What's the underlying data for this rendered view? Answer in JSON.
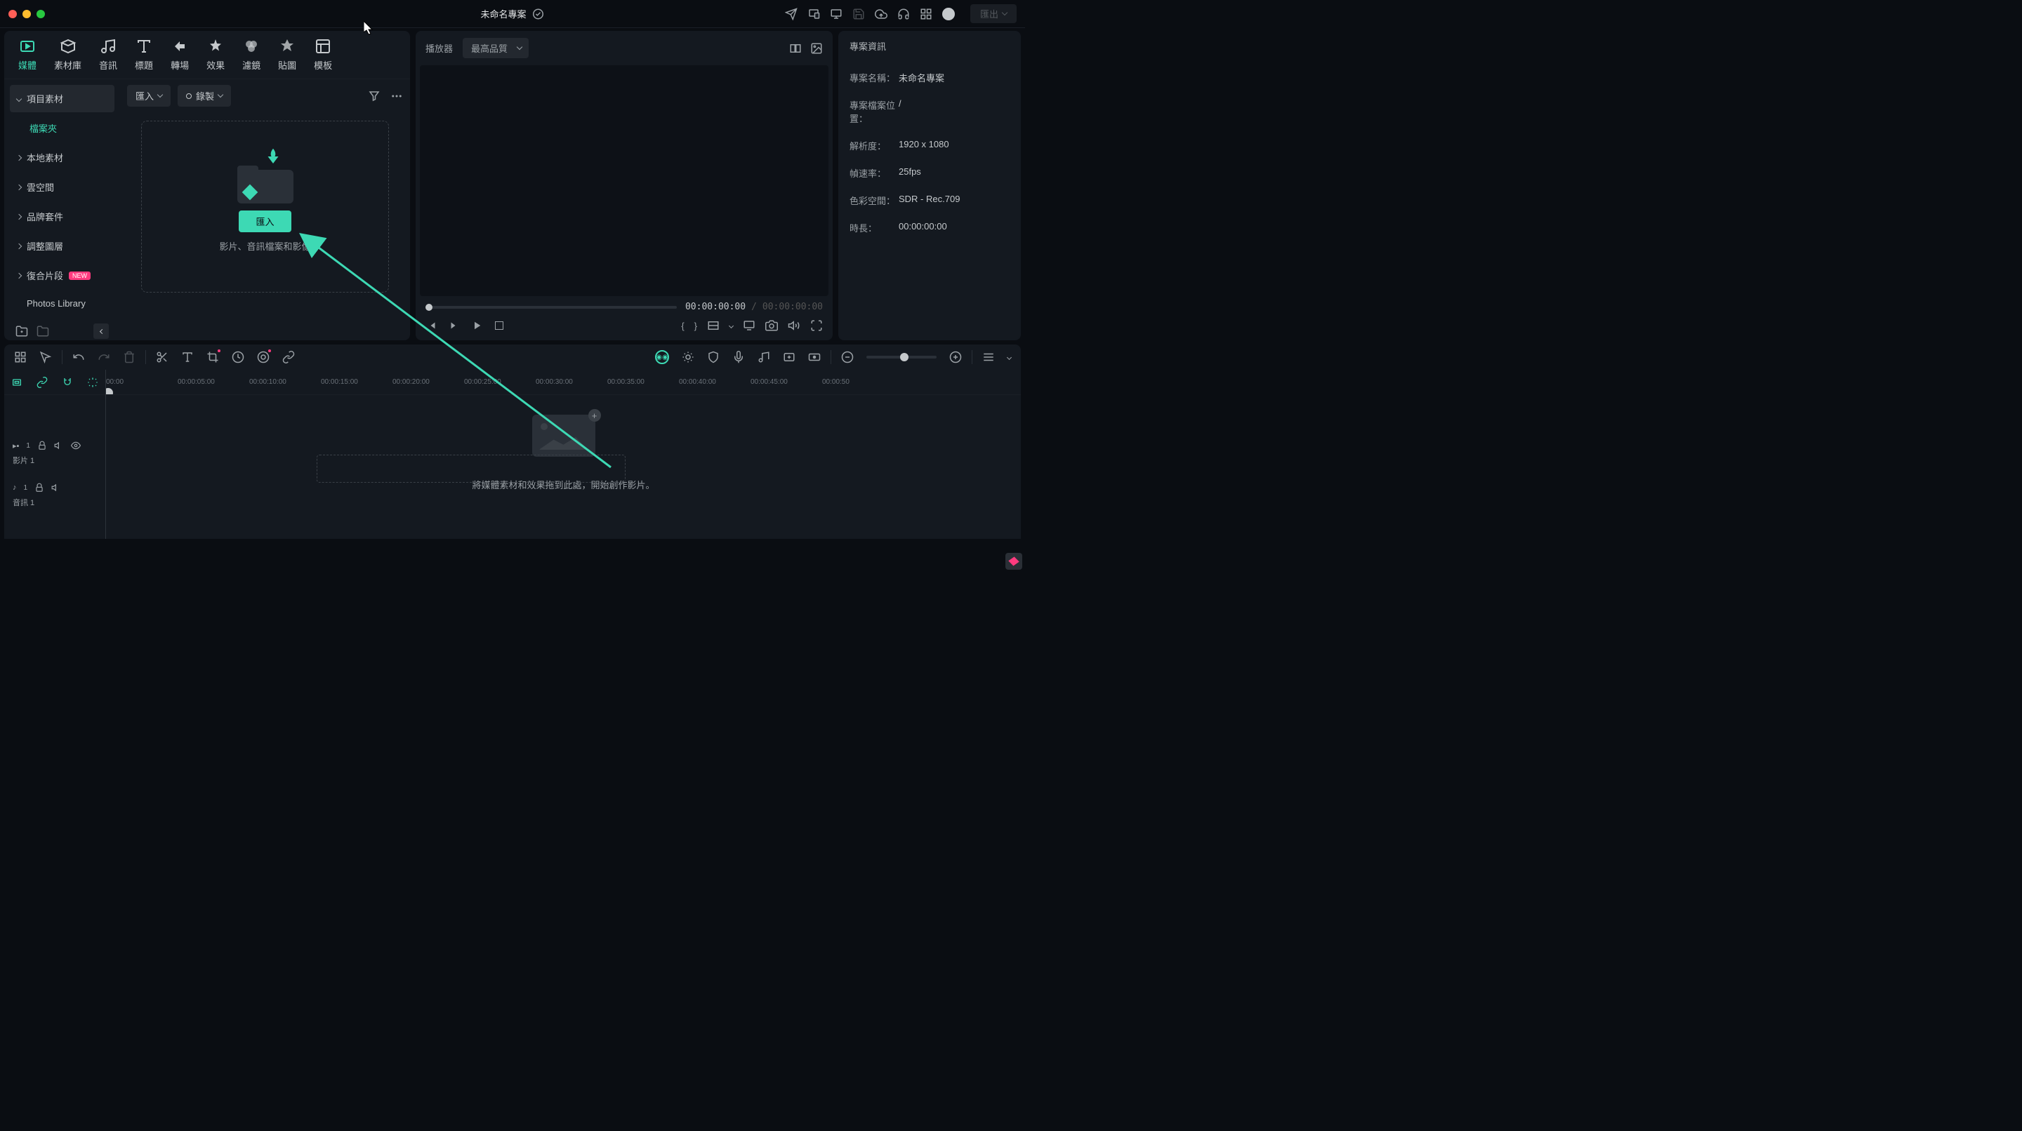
{
  "title": "未命名專案",
  "export_label": "匯出",
  "tool_tabs": [
    "媒體",
    "素材庫",
    "音訊",
    "標題",
    "轉場",
    "效果",
    "濾鏡",
    "貼圖",
    "模板"
  ],
  "sidebar": {
    "items": [
      {
        "label": "項目素材",
        "hl": true
      },
      {
        "label": "檔案夾",
        "accent": true
      },
      {
        "label": "本地素材"
      },
      {
        "label": "雲空間"
      },
      {
        "label": "品牌套件"
      },
      {
        "label": "調整圖層"
      },
      {
        "label": "復合片段",
        "badge": "NEW"
      },
      {
        "label": "Photos Library",
        "nochev": true
      }
    ]
  },
  "media_bar": {
    "import": "匯入",
    "record": "錄製"
  },
  "dropzone": {
    "button": "匯入",
    "hint": "影片、音訊檔案和影像"
  },
  "player": {
    "label": "播放器",
    "quality": "最高品質",
    "current": "00:00:00:00",
    "duration": "00:00:00:00"
  },
  "info": {
    "title": "專案資訊",
    "rows": [
      {
        "label": "專案名稱：",
        "val": "未命名專案"
      },
      {
        "label": "專案檔案位置：",
        "val": "/"
      },
      {
        "label": "解析度：",
        "val": "1920 x 1080"
      },
      {
        "label": "幀速率：",
        "val": "25fps"
      },
      {
        "label": "色彩空間：",
        "val": "SDR - Rec.709"
      },
      {
        "label": "時長：",
        "val": "00:00:00:00"
      }
    ]
  },
  "timeline": {
    "ticks": [
      "00:00",
      "00:00:05:00",
      "00:00:10:00",
      "00:00:15:00",
      "00:00:20:00",
      "00:00:25:00",
      "00:00:30:00",
      "00:00:35:00",
      "00:00:40:00",
      "00:00:45:00",
      "00:00:50"
    ],
    "video_track": "影片 1",
    "audio_track": "音訊 1",
    "hint": "將媒體素材和效果拖到此處，開始創作影片。"
  }
}
